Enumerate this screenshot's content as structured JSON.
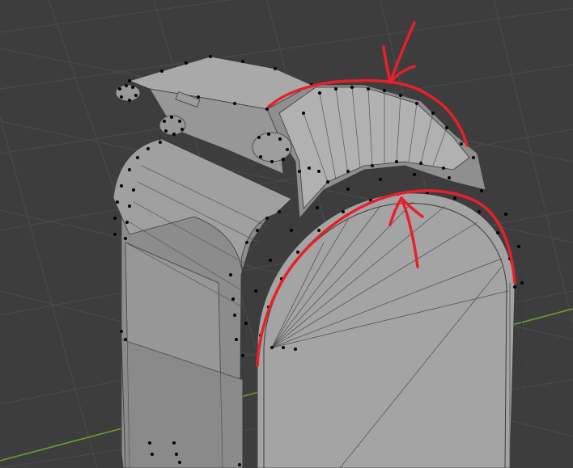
{
  "viewport": {
    "background_color": "#3d3d3d",
    "grid_line_color": "#4a4a4a",
    "x_axis_color": "#6d9a2c"
  },
  "model": {
    "object": "mailbox-mesh",
    "face_color": "#a3a3a3",
    "face_shade_color": "#8e8e8e",
    "face_dark_color": "#7a7a7a",
    "edge_color": "#3a3a3a",
    "vertex_color": "#000000"
  },
  "annotations": {
    "stroke_color": "#e8202a",
    "markers": [
      {
        "name": "top-arc-annotation",
        "shape": "arc-with-arrow",
        "arrow_direction": "down"
      },
      {
        "name": "door-arc-annotation",
        "shape": "arc-with-arrow",
        "arrow_direction": "up"
      }
    ]
  }
}
